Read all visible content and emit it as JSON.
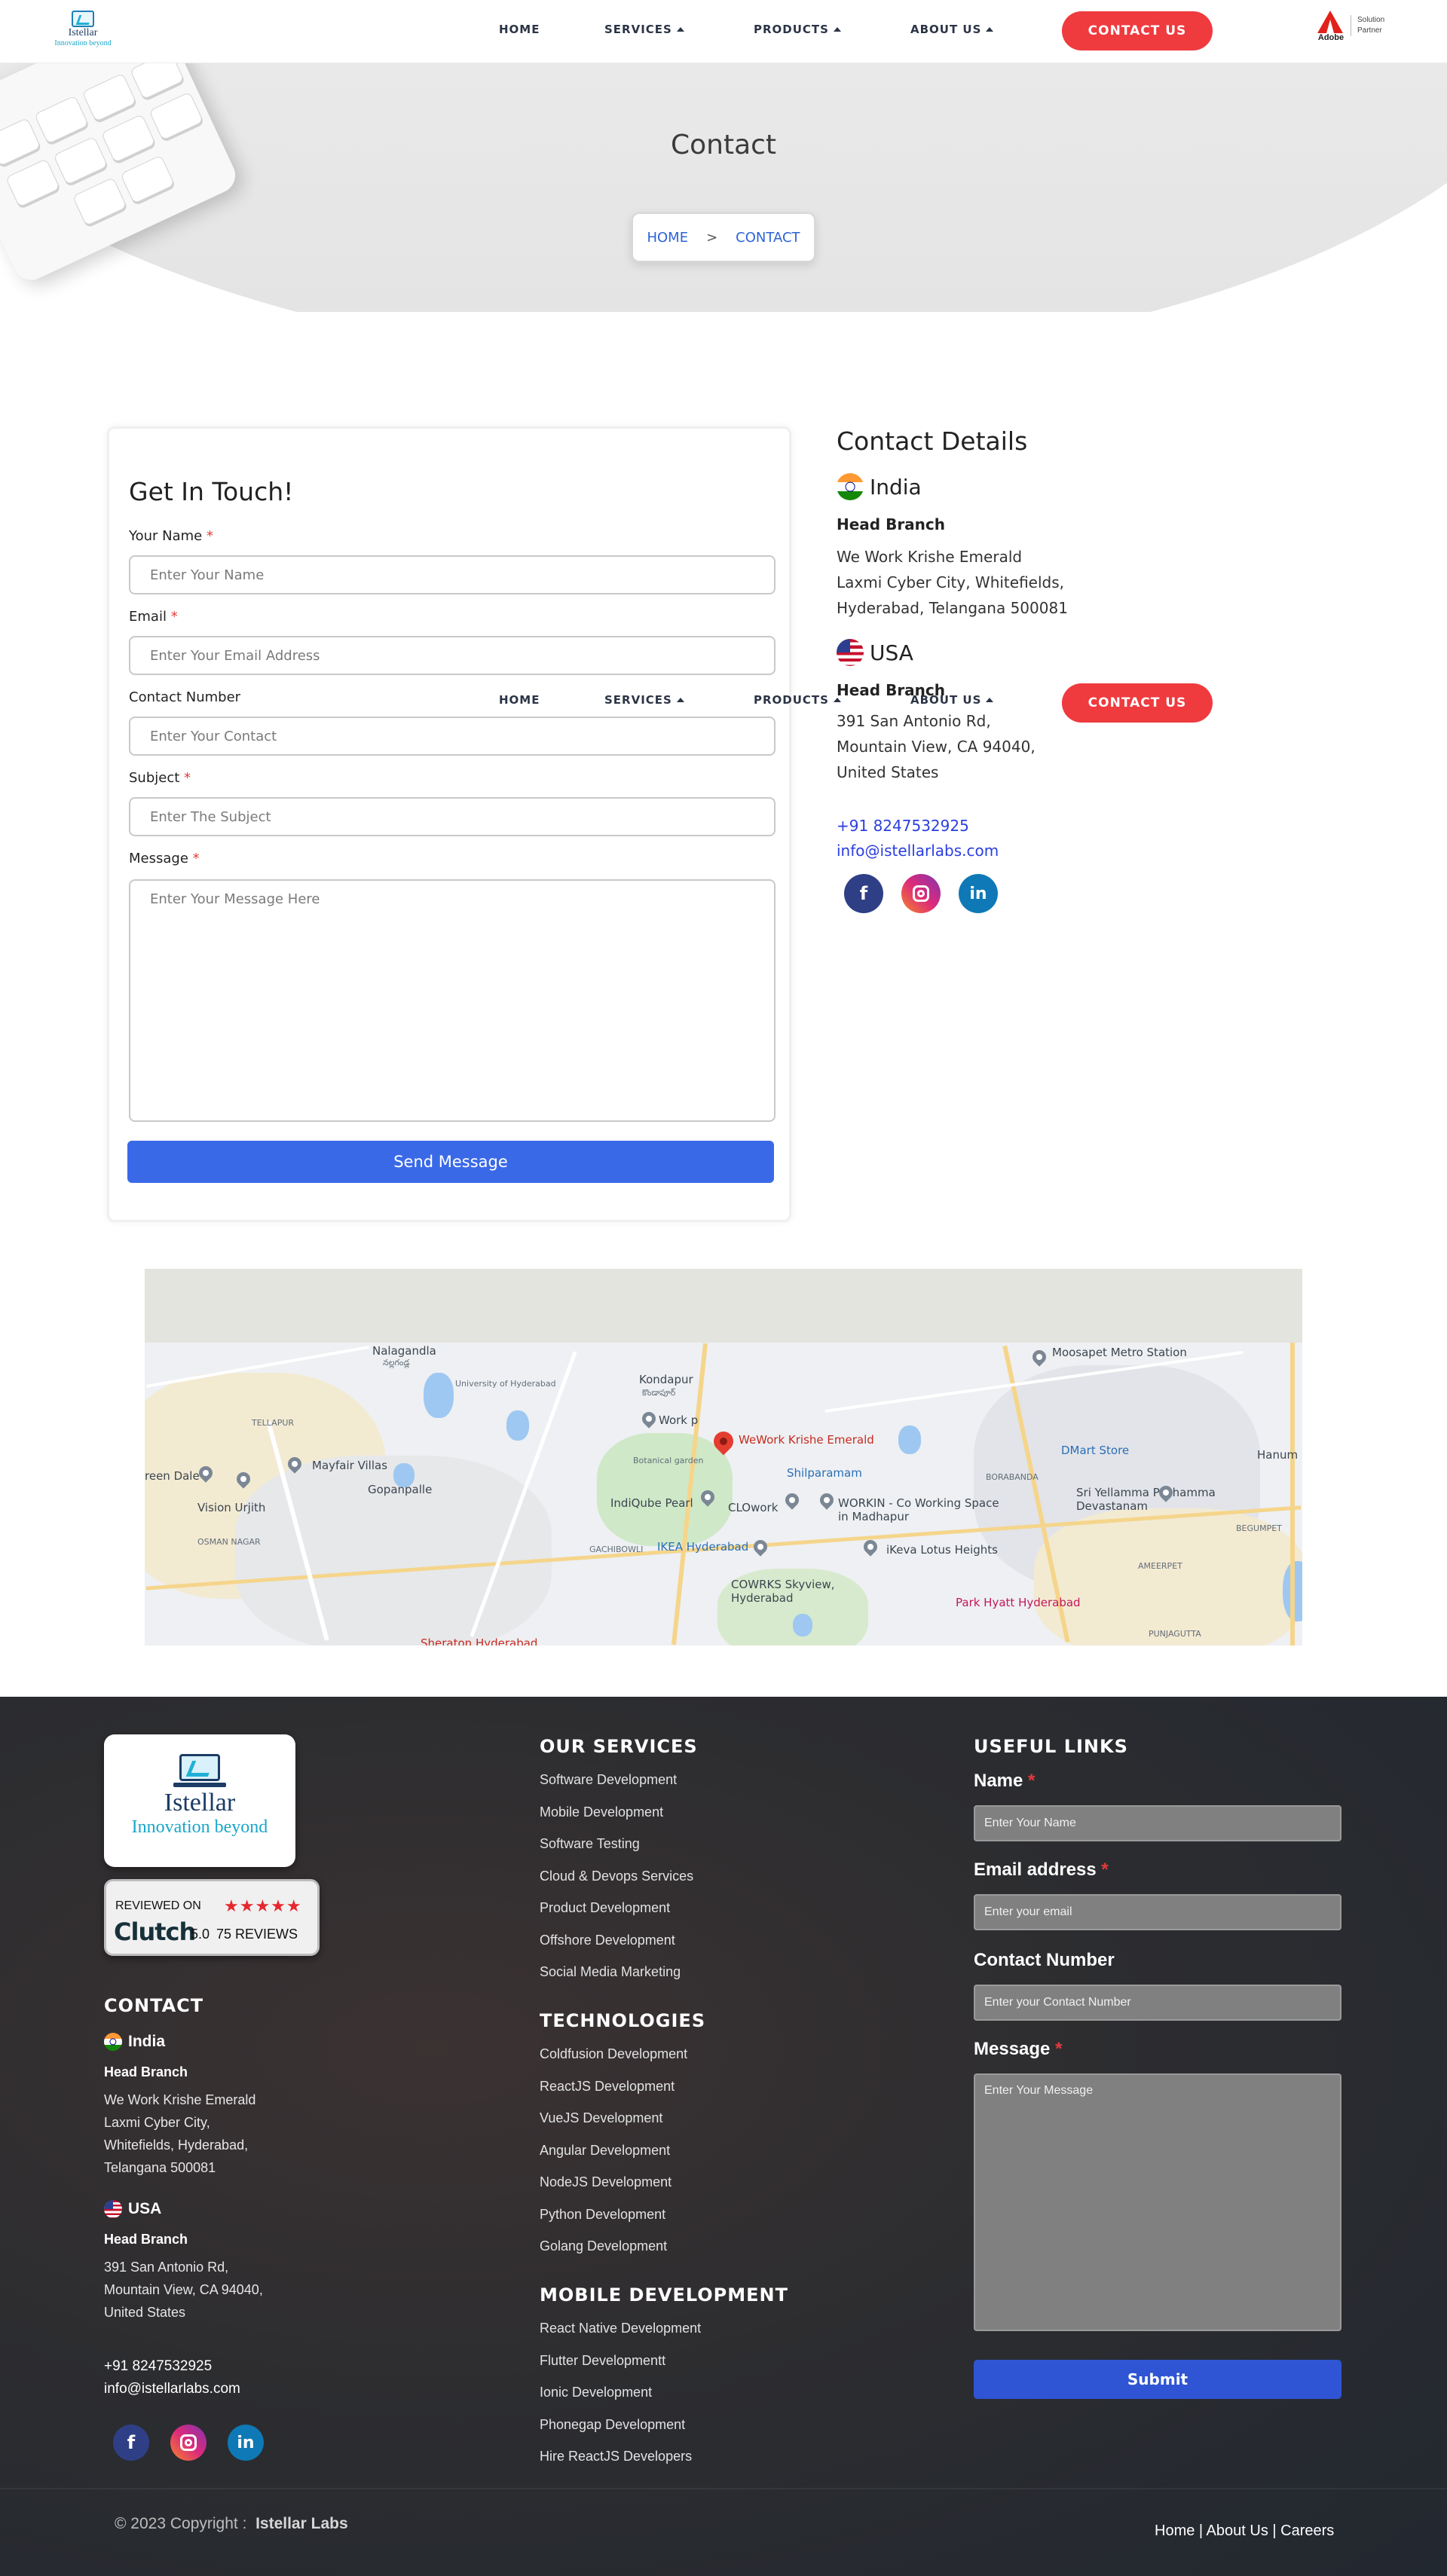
{
  "header": {
    "logo_name": "Istellar",
    "logo_tagline": "Innovation beyond",
    "nav": {
      "home": "HOME",
      "services": "SERVICES",
      "products": "PRODUCTS",
      "about": "ABOUT US"
    },
    "cta": "CONTACT US",
    "partner_brand": "Adobe",
    "partner_line1": "Solution",
    "partner_line2": "Partner"
  },
  "hero": {
    "title": "Contact",
    "breadcrumb_home": "HOME",
    "breadcrumb_sep": ">",
    "breadcrumb_current": "CONTACT"
  },
  "form": {
    "title": "Get In Touch!",
    "name_label": "Your Name",
    "name_placeholder": "Enter Your Name",
    "email_label": "Email",
    "email_placeholder": "Enter Your Email Address",
    "contact_label": "Contact Number",
    "contact_placeholder": "Enter Your Contact",
    "subject_label": "Subject",
    "subject_placeholder": "Enter The Subject",
    "message_label": "Message",
    "message_placeholder": "Enter Your Message Here",
    "required_mark": "*",
    "submit": "Send Message"
  },
  "details": {
    "title": "Contact Details",
    "india": {
      "country": "India",
      "branch": "Head Branch",
      "address_line1": "We Work Krishe Emerald",
      "address_line2": "Laxmi Cyber City, Whitefields,",
      "address_line3": "Hyderabad, Telangana 500081"
    },
    "usa": {
      "country": "USA",
      "branch": "Head Branch",
      "address_line1": "391 San Antonio Rd,",
      "address_line2": "Mountain View, CA 94040,",
      "address_line3": "United States"
    },
    "phone": "+91 8247532925",
    "email": "info@istellarlabs.com",
    "social": {
      "facebook": "f",
      "linkedin": "in"
    }
  },
  "map": {
    "labels": {
      "nalagandla": "Nalagandla",
      "nalagandla_te": "నల్లగండ్ల",
      "kondapur": "Kondapur",
      "kondapur_te": "కొండాపూర్",
      "uoh": "University of Hyderabad",
      "moosapet": "Moosapet Metro Station",
      "wework": "WeWork Krishe Emerald",
      "shilparamam": "Shilparamam",
      "workp": "Work p",
      "tellapur": "TELLAPUR",
      "mayfair": "Mayfair Villas",
      "vision": "Vision Urjith",
      "gopanpalle": "Gopanpalle",
      "greendale": "reen Dale",
      "osman": "OSMAN NAGAR",
      "indiqube": "IndiQube Pearl",
      "cloworl": "CLOwork",
      "workin": "WORKIN - Co Working Space in Madhapur",
      "botanical": "Botanical garden",
      "ikea": "IKEA Hyderabad",
      "ikeva": "iKeva Lotus Heights",
      "cowrks": "COWRKS Skyview, Hyderabad",
      "parkhyatt": "Park Hyatt Hyderabad",
      "dmart": "DMart Store",
      "sriyellamma": "Sri Yellamma Pochamma Devastanam",
      "borabanda": "BORABANDA",
      "sheraton": "Sheraton Hyderabad",
      "gachibowli": "GACHIBOWLI",
      "punjagutta": "PUNJAGUTTA",
      "begumpet": "BEGUMPET",
      "ameerpet": "AMEERPET",
      "hanum": "Hanum"
    }
  },
  "footer": {
    "logo_name": "Istellar",
    "logo_tagline": "Innovation beyond",
    "clutch_reviewed": "REVIEWED ON",
    "clutch_word": "Clutch",
    "clutch_score": "5.0",
    "clutch_reviews": "75 REVIEWS",
    "contact_title": "CONTACT",
    "india": {
      "country": "India",
      "branch": "Head Branch",
      "address_line1": "We Work Krishe Emerald",
      "address_line2": "Laxmi Cyber City,",
      "address_line3": "Whitefields, Hyderabad,",
      "address_line4": "Telangana 500081"
    },
    "usa": {
      "country": "USA",
      "branch": "Head Branch",
      "address_line1": "391 San Antonio Rd,",
      "address_line2": "Mountain View, CA 94040,",
      "address_line3": "United States"
    },
    "phone": "+91 8247532925",
    "email": "info@istellarlabs.com",
    "services_title": "OUR SERVICES",
    "services": [
      "Software Development",
      "Mobile Development",
      "Software Testing",
      "Cloud & Devops Services",
      "Product Development",
      "Offshore Development",
      "Social Media Marketing"
    ],
    "tech_title": "TECHNOLOGIES",
    "technologies": [
      "Coldfusion Development",
      "ReactJS Development",
      "VueJS Development",
      "Angular Development",
      "NodeJS Development",
      "Python Development",
      "Golang Development"
    ],
    "mobile_title": "MOBILE DEVELOPMENT",
    "mobile": [
      "React Native Development",
      "Flutter Developmentt",
      "Ionic Development",
      "Phonegap Development",
      "Hire ReactJS Developers"
    ],
    "useful_title": "USEFUL LINKS",
    "uform": {
      "name_label": "Name",
      "name_placeholder": "Enter Your Name",
      "email_label": "Email address",
      "email_placeholder": "Enter your email",
      "contact_label": "Contact Number",
      "contact_placeholder": "Enter your Contact Number",
      "message_label": "Message",
      "message_placeholder": "Enter Your Message",
      "required_mark": "*",
      "submit": "Submit"
    },
    "copyright": "© 2023 Copyright :",
    "copyright_brand": "Istellar Labs",
    "bottom_links": "Home | About Us | Careers"
  }
}
